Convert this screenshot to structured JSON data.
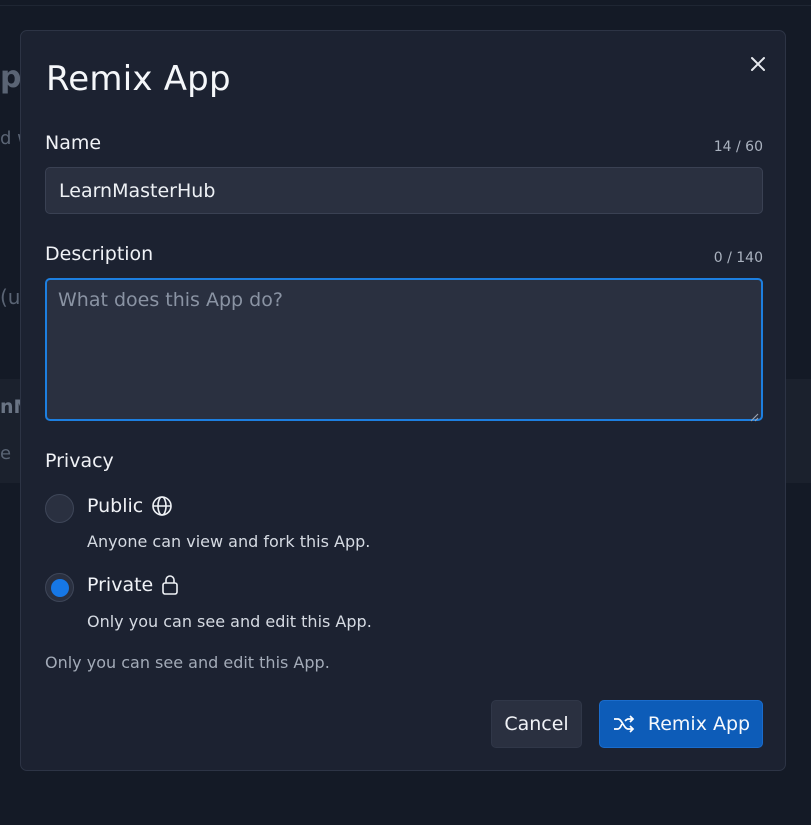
{
  "background": {
    "fragments": [
      "ps",
      "d w",
      "(u",
      "nM",
      "e"
    ]
  },
  "modal": {
    "title": "Remix App",
    "close_icon": "close-icon"
  },
  "name_field": {
    "label": "Name",
    "counter": "14 / 60",
    "value": "LearnMasterHub"
  },
  "description_field": {
    "label": "Description",
    "counter": "0 / 140",
    "value": "",
    "placeholder": "What does this App do?"
  },
  "privacy": {
    "label": "Privacy",
    "options": [
      {
        "label": "Public",
        "icon": "globe-icon",
        "description": "Anyone can view and fork this App.",
        "selected": false
      },
      {
        "label": "Private",
        "icon": "lock-icon",
        "description": "Only you can see and edit this App.",
        "selected": true
      }
    ],
    "helper_text": "Only you can see and edit this App."
  },
  "actions": {
    "cancel_label": "Cancel",
    "remix_label": "Remix App",
    "remix_icon": "shuffle-icon"
  },
  "colors": {
    "accent": "#1677e6",
    "primary_button": "#0d5cb8",
    "focus_border": "#1d7fe0",
    "modal_bg": "#1c2231"
  }
}
